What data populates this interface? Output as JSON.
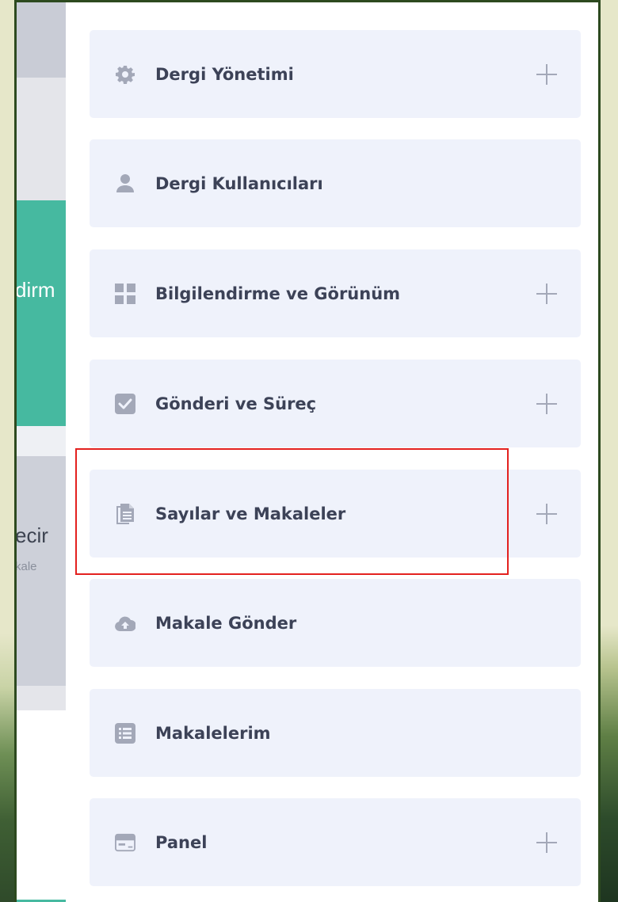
{
  "background": {
    "fragment_1": "dirm",
    "fragment_2": "ecir",
    "fragment_3": "kale"
  },
  "menu": {
    "items": [
      {
        "label": "Dergi Yönetimi",
        "icon": "gear-icon",
        "expandable": true
      },
      {
        "label": "Dergi Kullanıcıları",
        "icon": "user-icon",
        "expandable": false
      },
      {
        "label": "Bilgilendirme ve Görünüm",
        "icon": "grid-icon",
        "expandable": true
      },
      {
        "label": "Gönderi ve Süreç",
        "icon": "checkbox-icon",
        "expandable": true
      },
      {
        "label": "Sayılar ve Makaleler",
        "icon": "documents-icon",
        "expandable": true,
        "highlighted": true
      },
      {
        "label": "Makale Gönder",
        "icon": "cloud-upload-icon",
        "expandable": false
      },
      {
        "label": "Makalelerim",
        "icon": "list-icon",
        "expandable": false
      },
      {
        "label": "Panel",
        "icon": "panel-icon",
        "expandable": true
      }
    ]
  },
  "colors": {
    "item_bg": "#eff2fb",
    "label": "#3c4257",
    "icon": "#a3a8b8",
    "highlight_border": "#e3211f",
    "frame": "#2d4a1f",
    "accent_teal": "#46b9a0"
  }
}
